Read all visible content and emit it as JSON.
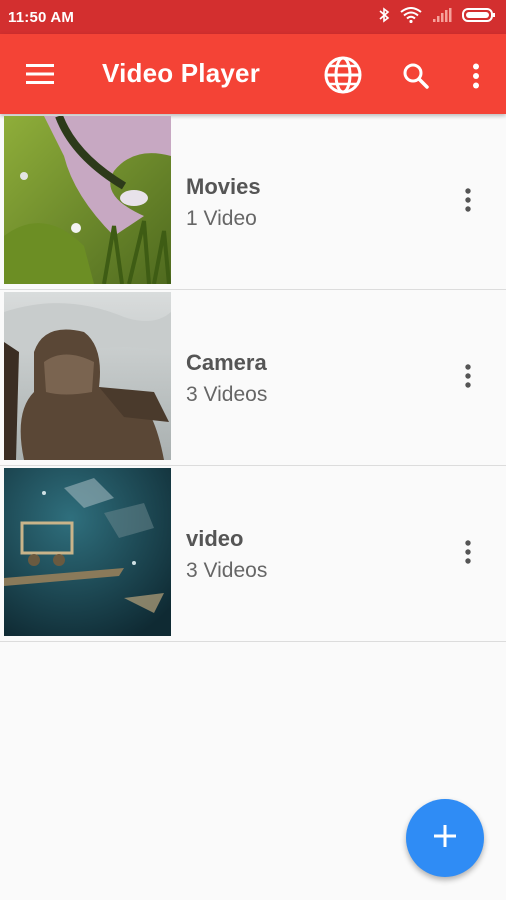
{
  "status_bar": {
    "time": "11:50 AM"
  },
  "toolbar": {
    "title": "Video Player",
    "icons": [
      "menu-icon",
      "globe-icon",
      "search-icon",
      "more-vert-icon"
    ]
  },
  "folders": [
    {
      "name": "Movies",
      "count": "1 Video"
    },
    {
      "name": "Camera",
      "count": "3 Videos"
    },
    {
      "name": "video",
      "count": "3 Videos"
    }
  ],
  "colors": {
    "status_bar": "#d32f2f",
    "toolbar": "#f44336",
    "fab": "#2f8cf5"
  }
}
